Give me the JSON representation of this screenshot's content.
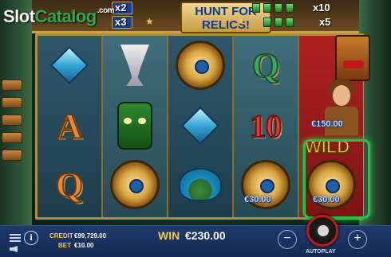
{
  "header": {
    "watermark": {
      "slot": "Slot",
      "catalog": "Catalog",
      "dotcom": ".com"
    },
    "title": "HUNT FOR RELICS!",
    "left_multipliers": [
      "x2",
      "x3"
    ],
    "right_multipliers": [
      "x10",
      "x5"
    ]
  },
  "reels": {
    "symbol_values": [
      "€150.00",
      "€30.00",
      "€30.00"
    ],
    "wild_label": "WILD"
  },
  "bottom_bar": {
    "credit_label": "CREDIT",
    "credit_value": "€99,729.00",
    "bet_label": "BET",
    "bet_value": "€10.00",
    "win_label": "WIN",
    "win_value": "€230.00",
    "minus_label": "−",
    "plus_label": "+",
    "autoplay_label": "AUTOPLAY",
    "info_label": "i"
  },
  "colors": {
    "accent": "#f2c94c",
    "bar": "#1f3a6e",
    "spin_ring": "#c01818",
    "highlight": "#27c04a"
  },
  "icons": [
    "menu-icon",
    "info-icon",
    "speaker-icon",
    "spin-icon"
  ]
}
